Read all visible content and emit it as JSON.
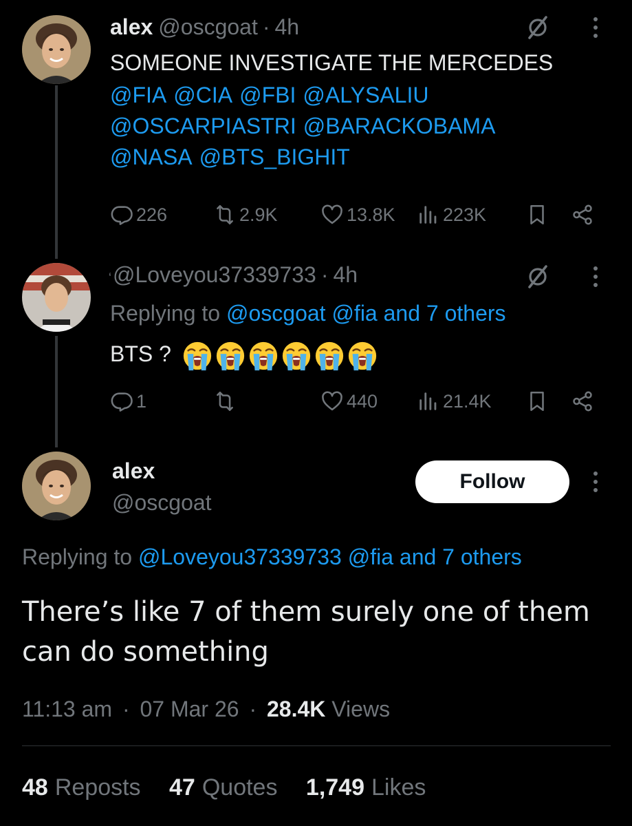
{
  "tweet1": {
    "name": "alex",
    "handle": "@oscgoat",
    "dot": "·",
    "time": "4h",
    "text": "SOMEONE INVESTIGATE THE MERCEDES",
    "mentions": [
      "@FIA",
      "@CIA",
      "@FBI",
      "@ALYSALIU",
      "@OSCARPIASTRI",
      "@BARACKOBAMA",
      "@NASA",
      "@BTS_BIGHIT"
    ],
    "replies": "226",
    "reposts": "2.9K",
    "likes": "13.8K",
    "views": "223K"
  },
  "tweet2": {
    "handle": "@Loveyou37339733",
    "dot": "·",
    "time": "4h",
    "replying_prefix": "Replying to",
    "replying_links": "@oscgoat @fia and 7 others",
    "text": "BTS ?",
    "emoji": "loudly-crying-face",
    "emoji_count": 6,
    "replies": "1",
    "reposts": "",
    "likes": "440",
    "views": "21.4K"
  },
  "main": {
    "name": "alex",
    "handle": "@oscgoat",
    "follow_label": "Follow",
    "replying_prefix": "Replying to",
    "replying_links": "@Loveyou37339733 @fia and 7 others",
    "text": "There’s like 7 of them surely one of them can do something",
    "time": "11:13 am",
    "dot": "·",
    "date": "07 Mar 26",
    "views_count": "28.4K",
    "views_label": "Views",
    "reposts_count": "48",
    "reposts_label": "Reposts",
    "quotes_count": "47",
    "quotes_label": "Quotes",
    "likes_count": "1,749",
    "likes_label": "Likes"
  },
  "colors": {
    "background": "#000000",
    "text": "#e7e9ea",
    "secondary": "#71767b",
    "link": "#1d9bf0",
    "divider": "#2f3336"
  }
}
